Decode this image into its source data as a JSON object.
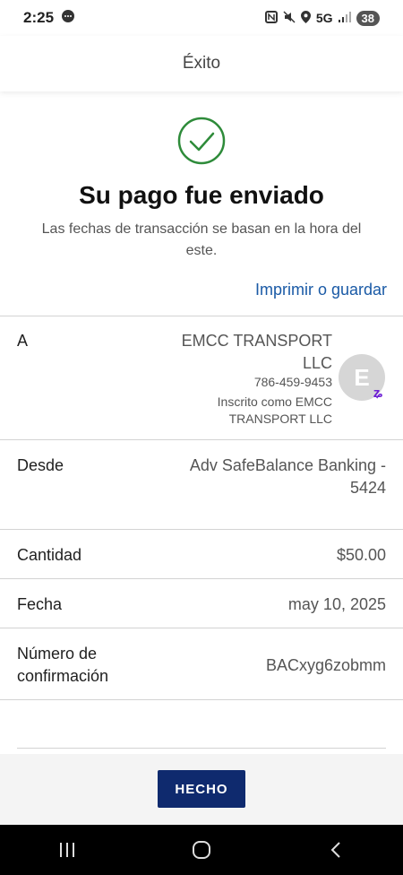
{
  "status_bar": {
    "time": "2:25",
    "network": "5G",
    "battery": "38"
  },
  "header": {
    "title": "Éxito"
  },
  "success": {
    "title": "Su pago fue enviado",
    "subtitle": "Las fechas de transacción se basan en la hora del este."
  },
  "actions": {
    "print_label": "Imprimir o guardar"
  },
  "details": {
    "to_label": "A",
    "to_name": "EMCC TRANSPORT LLC",
    "to_phone": "786-459-9453",
    "to_registered": "Inscrito como EMCC TRANSPORT LLC",
    "avatar_letter": "E",
    "from_label": "Desde",
    "from_value": "Adv SafeBalance Banking - 5424",
    "amount_label": "Cantidad",
    "amount_value": "$50.00",
    "date_label": "Fecha",
    "date_value": "may 10, 2025",
    "confirmation_label": "Número de confirmación",
    "confirmation_value": "BACxyg6zobmm"
  },
  "footer": {
    "done_label": "HECHO"
  },
  "colors": {
    "link": "#1a5aa6",
    "success": "#2e8b3a",
    "primary_button": "#0f2a6e"
  }
}
